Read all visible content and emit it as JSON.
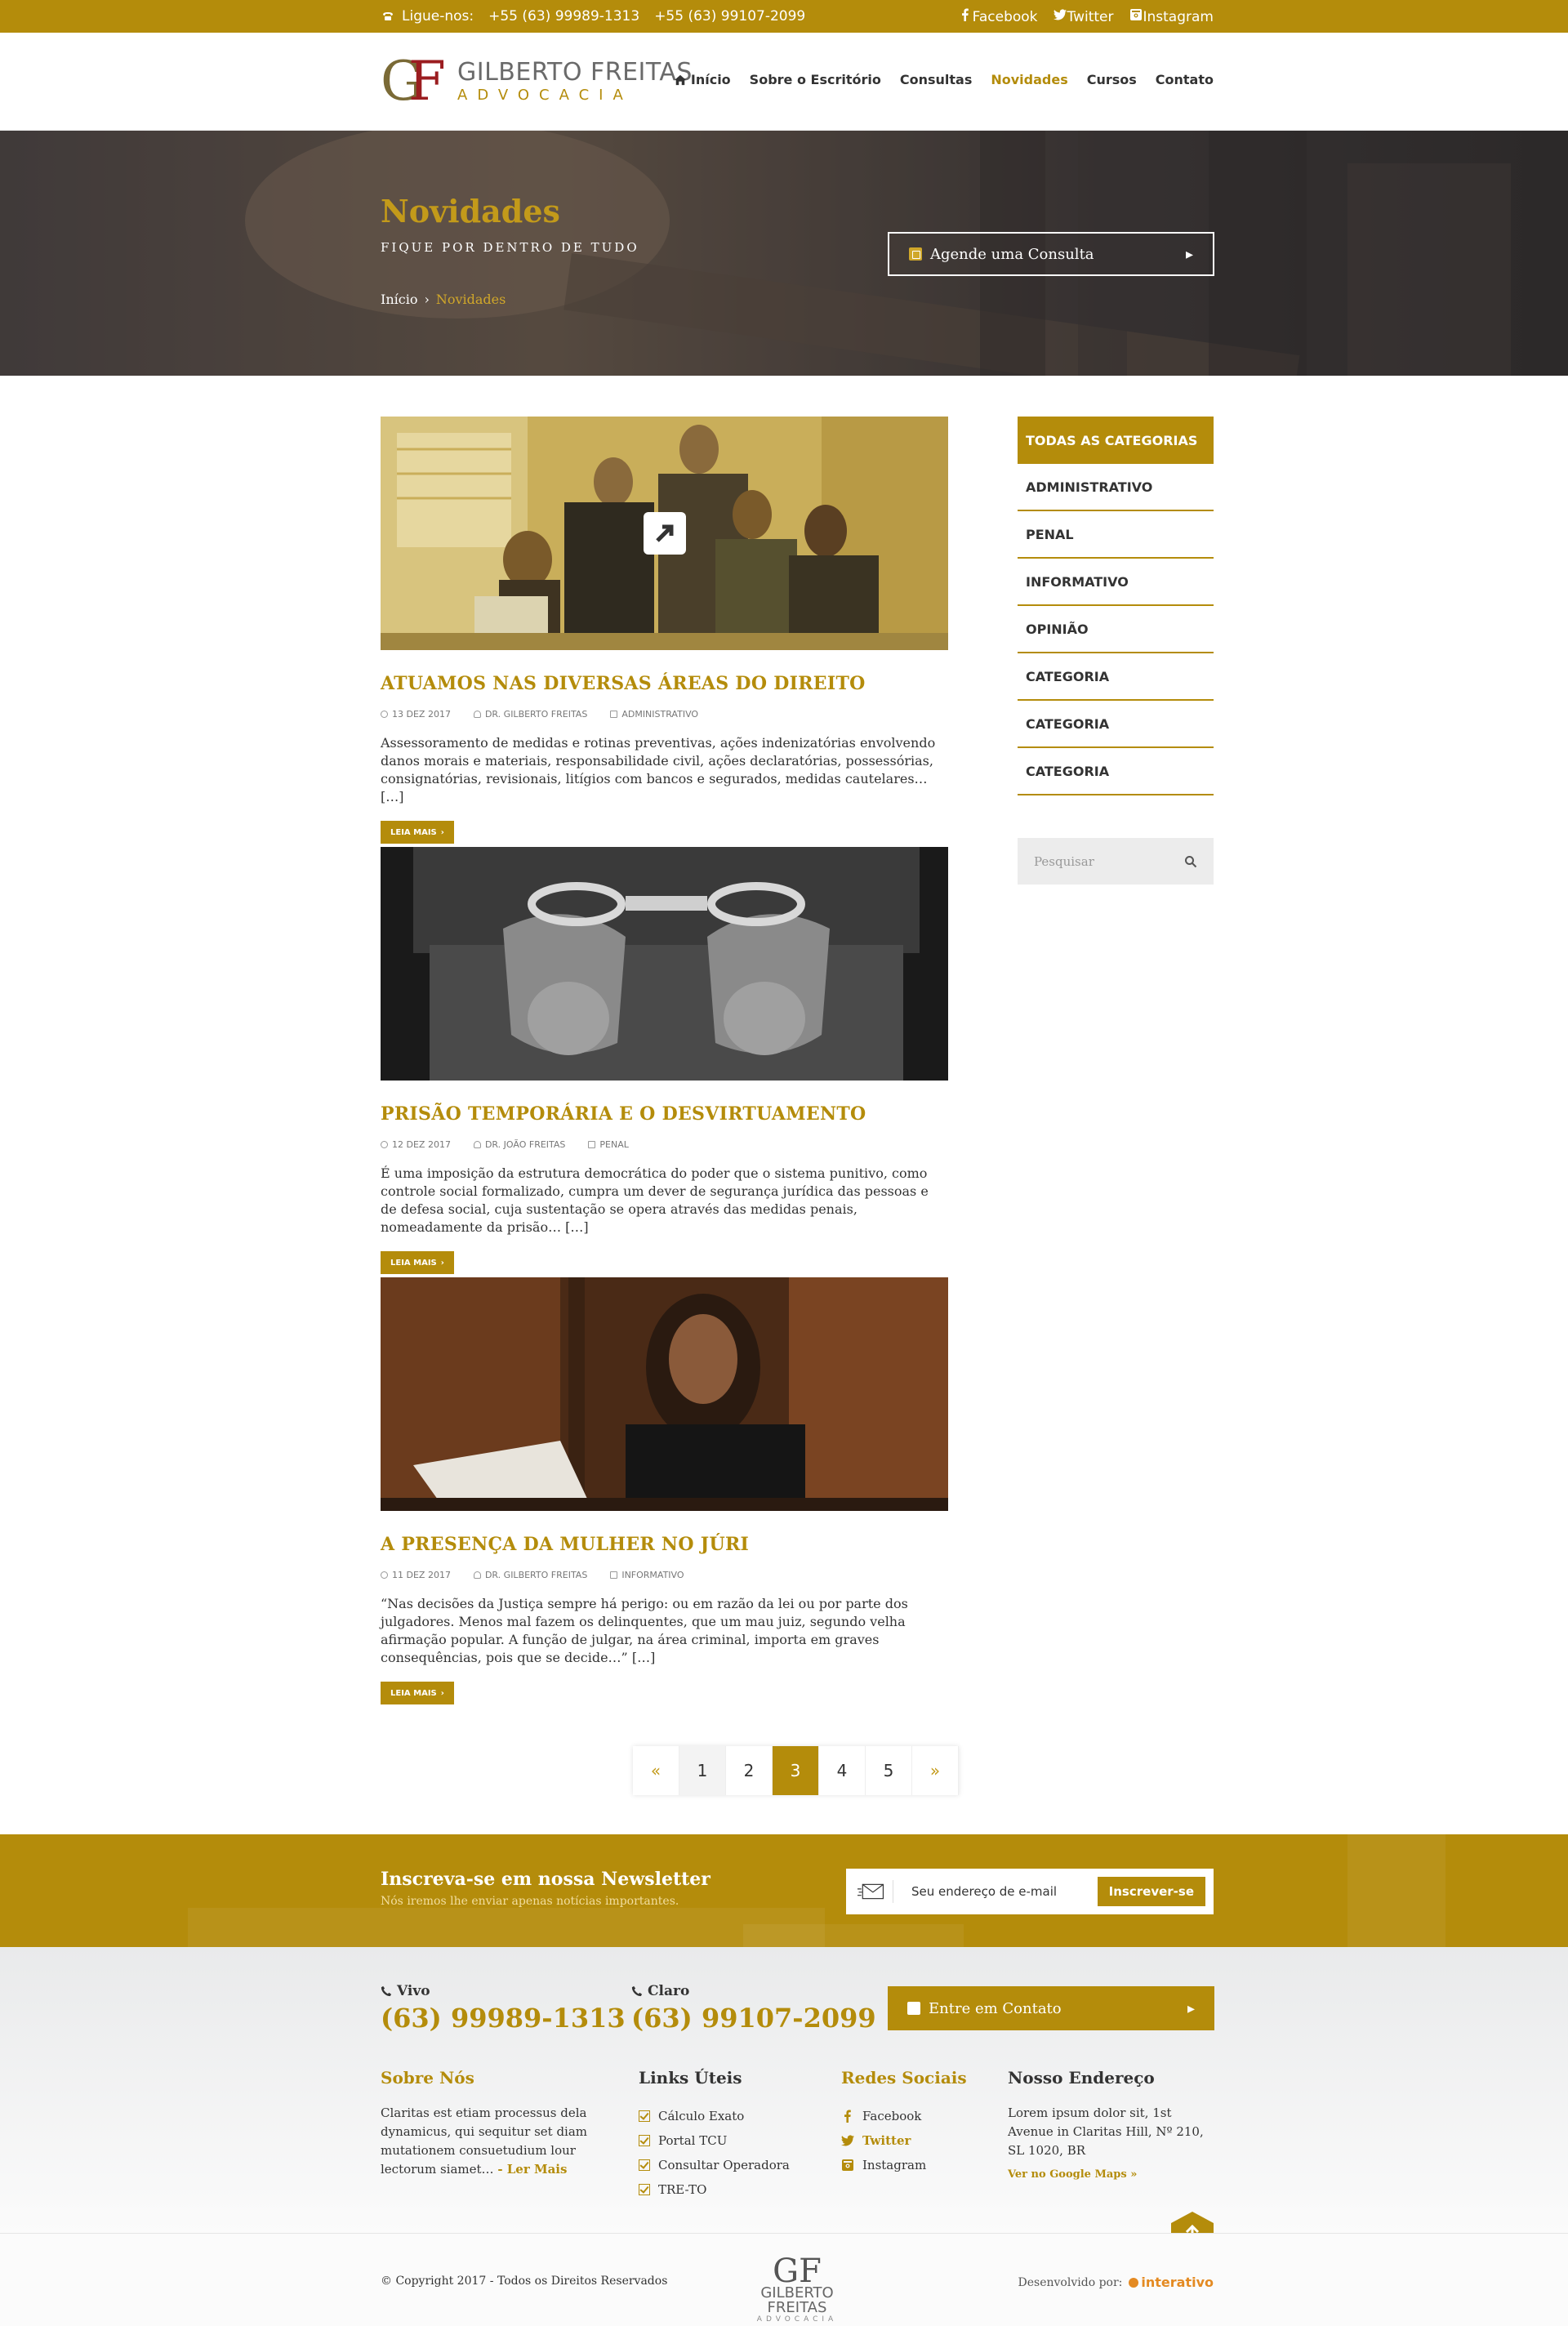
{
  "topbar": {
    "call_label": "Ligue-nos:",
    "phone1": "+55 (63) 99989-1313",
    "phone2": "+55 (63) 99107-2099",
    "social": [
      "Facebook",
      "Twitter",
      "Instagram"
    ]
  },
  "header": {
    "logo_initials_g": "G",
    "logo_initials_f": "F",
    "logo_name": "GILBERTO FREITAS",
    "logo_sub": "ADVOCACIA",
    "nav": [
      "Início",
      "Sobre o Escritório",
      "Consultas",
      "Novidades",
      "Cursos",
      "Contato"
    ],
    "active": "Novidades"
  },
  "hero": {
    "title": "Novidades",
    "subtitle": "FIQUE POR DENTRO DE TUDO",
    "breadcrumb_home": "Início",
    "breadcrumb_sep": "›",
    "breadcrumb_current": "Novidades",
    "cta": "Agende uma Consulta"
  },
  "posts": [
    {
      "title": "ATUAMOS NAS DIVERSAS ÁREAS DO DIREITO",
      "date": "13 DEZ 2017",
      "author": "DR. GILBERTO FREITAS",
      "category": "ADMINISTRATIVO",
      "excerpt": "Assessoramento de medidas e rotinas preventivas, ações indenizatórias envolvendo danos morais e materiais, responsabilidade civil, ações declaratórias, possessórias, consignatórias, revisionais, litígios com bancos e segurados, medidas cautelares… […]",
      "read_more": "LEIA MAIS"
    },
    {
      "title": "PRISÃO TEMPORÁRIA E O DESVIRTUAMENTO",
      "date": "12 DEZ 2017",
      "author": "DR. JOÃO FREITAS",
      "category": "PENAL",
      "excerpt": "É uma imposição da estrutura democrática do poder que o sistema punitivo, como controle social formalizado, cumpra um dever de segurança jurídica das pessoas e de defesa social, cuja sustentação se opera através das medidas penais, nomeadamente da prisão… […]",
      "read_more": "LEIA MAIS"
    },
    {
      "title": "A PRESENÇA DA MULHER NO JÚRI",
      "date": "11 DEZ 2017",
      "author": "DR. GILBERTO FREITAS",
      "category": "INFORMATIVO",
      "excerpt": "“Nas decisões da Justiça sempre há perigo: ou em razão da lei ou por parte dos julgadores. Menos mal fazem os delinquentes, que um mau juiz, segundo velha afirmação popular. A função de julgar, na área criminal, importa em graves consequências, pois que se decide…” […]",
      "read_more": "LEIA MAIS"
    }
  ],
  "sidebar": {
    "categories": [
      "TODAS AS CATEGORIAS",
      "ADMINISTRATIVO",
      "PENAL",
      "INFORMATIVO",
      "OPINIÃO",
      "CATEGORIA",
      "CATEGORIA",
      "CATEGORIA"
    ],
    "search_placeholder": "Pesquisar"
  },
  "pagination": {
    "prev": "«",
    "pages": [
      "1",
      "2",
      "3",
      "4",
      "5"
    ],
    "current": "3",
    "next": "»"
  },
  "newsletter": {
    "title": "Inscreva-se em nossa Newsletter",
    "subtitle": "Nós iremos lhe enviar apenas notícias importantes.",
    "placeholder": "Seu endereço de e-mail",
    "button": "Inscrever-se"
  },
  "footer": {
    "phone_vivo_label": "Vivo",
    "phone_vivo": "(63) 99989-1313",
    "phone_claro_label": "Claro",
    "phone_claro": "(63) 99107-2099",
    "cta": "Entre em Contato",
    "about_title": "Sobre Nós",
    "about_text": "Claritas est etiam processus dela dynamicus, qui sequitur set diam mutationem consuetudium lour lectorum siamet…",
    "about_more": "- Ler Mais",
    "links_title": "Links Úteis",
    "links": [
      "Cálculo Exato",
      "Portal TCU",
      "Consultar Operadora",
      "TRE-TO"
    ],
    "social_title": "Redes Sociais",
    "social": [
      "Facebook",
      "Twitter",
      "Instagram"
    ],
    "address_title": "Nosso Endereço",
    "address": "Lorem ipsum dolor sit, 1st Avenue in Claritas Hill, Nº 210, SL 1020, BR",
    "map_link": "Ver no Google Maps »"
  },
  "bottom": {
    "copyright": "© Copyright 2017 - Todos os Direitos Reservados",
    "logo_initials": "GF",
    "logo_name": "GILBERTO FREITAS",
    "logo_sub": "ADVOCACIA",
    "dev_label": "Desenvolvido por:",
    "dev_brand": "interativo"
  },
  "colors": {
    "accent": "#b48c0b",
    "logo_red": "#9b1d20",
    "dark": "#333333"
  }
}
